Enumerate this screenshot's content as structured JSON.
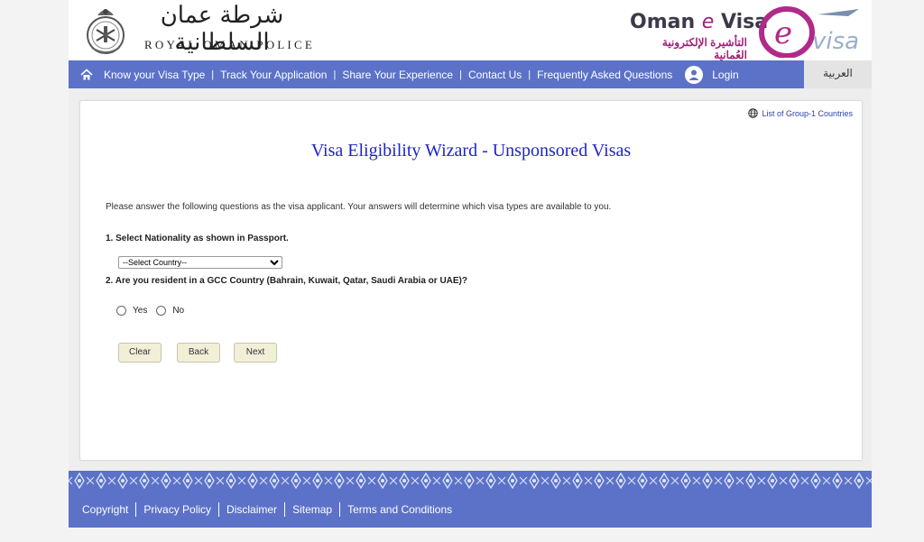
{
  "header": {
    "rop_arabic": "شرطة عمان السلطانية",
    "rop_english": "ROYAL OMAN POLICE",
    "evisa_title_1": "Oman ",
    "evisa_title_e": "e",
    "evisa_title_2": " Visa",
    "evisa_arabic": "التأشيرة الإلكترونية العُمانية"
  },
  "nav": {
    "items": [
      {
        "label": "Know your Visa Type"
      },
      {
        "label": "Track Your Application"
      },
      {
        "label": "Share Your Experience"
      },
      {
        "label": "Contact Us"
      },
      {
        "label": "Frequently Asked Questions"
      }
    ],
    "login": "Login",
    "language": "العربية"
  },
  "main": {
    "group_link": "List of Group-1 Countries",
    "title": "Visa Eligibility Wizard - Unsponsored Visas",
    "intro": "Please answer the following questions as the visa applicant. Your answers will determine which visa types are available to you.",
    "q1": "1. Select Nationality as shown in Passport.",
    "country_select": "--Select Country--",
    "q2": "2. Are you resident in a GCC Country (Bahrain, Kuwait, Qatar, Saudi Arabia or UAE)?",
    "yes": "Yes",
    "no": "No",
    "clear": "Clear",
    "back": "Back",
    "next": "Next"
  },
  "footer": {
    "items": [
      "Copyright",
      "Privacy Policy",
      "Disclaimer",
      "Sitemap",
      "Terms and Conditions"
    ]
  },
  "colors": {
    "nav_blue": "#5b72c8",
    "title_blue": "#1f25c8",
    "brand_magenta": "#a0207a"
  }
}
